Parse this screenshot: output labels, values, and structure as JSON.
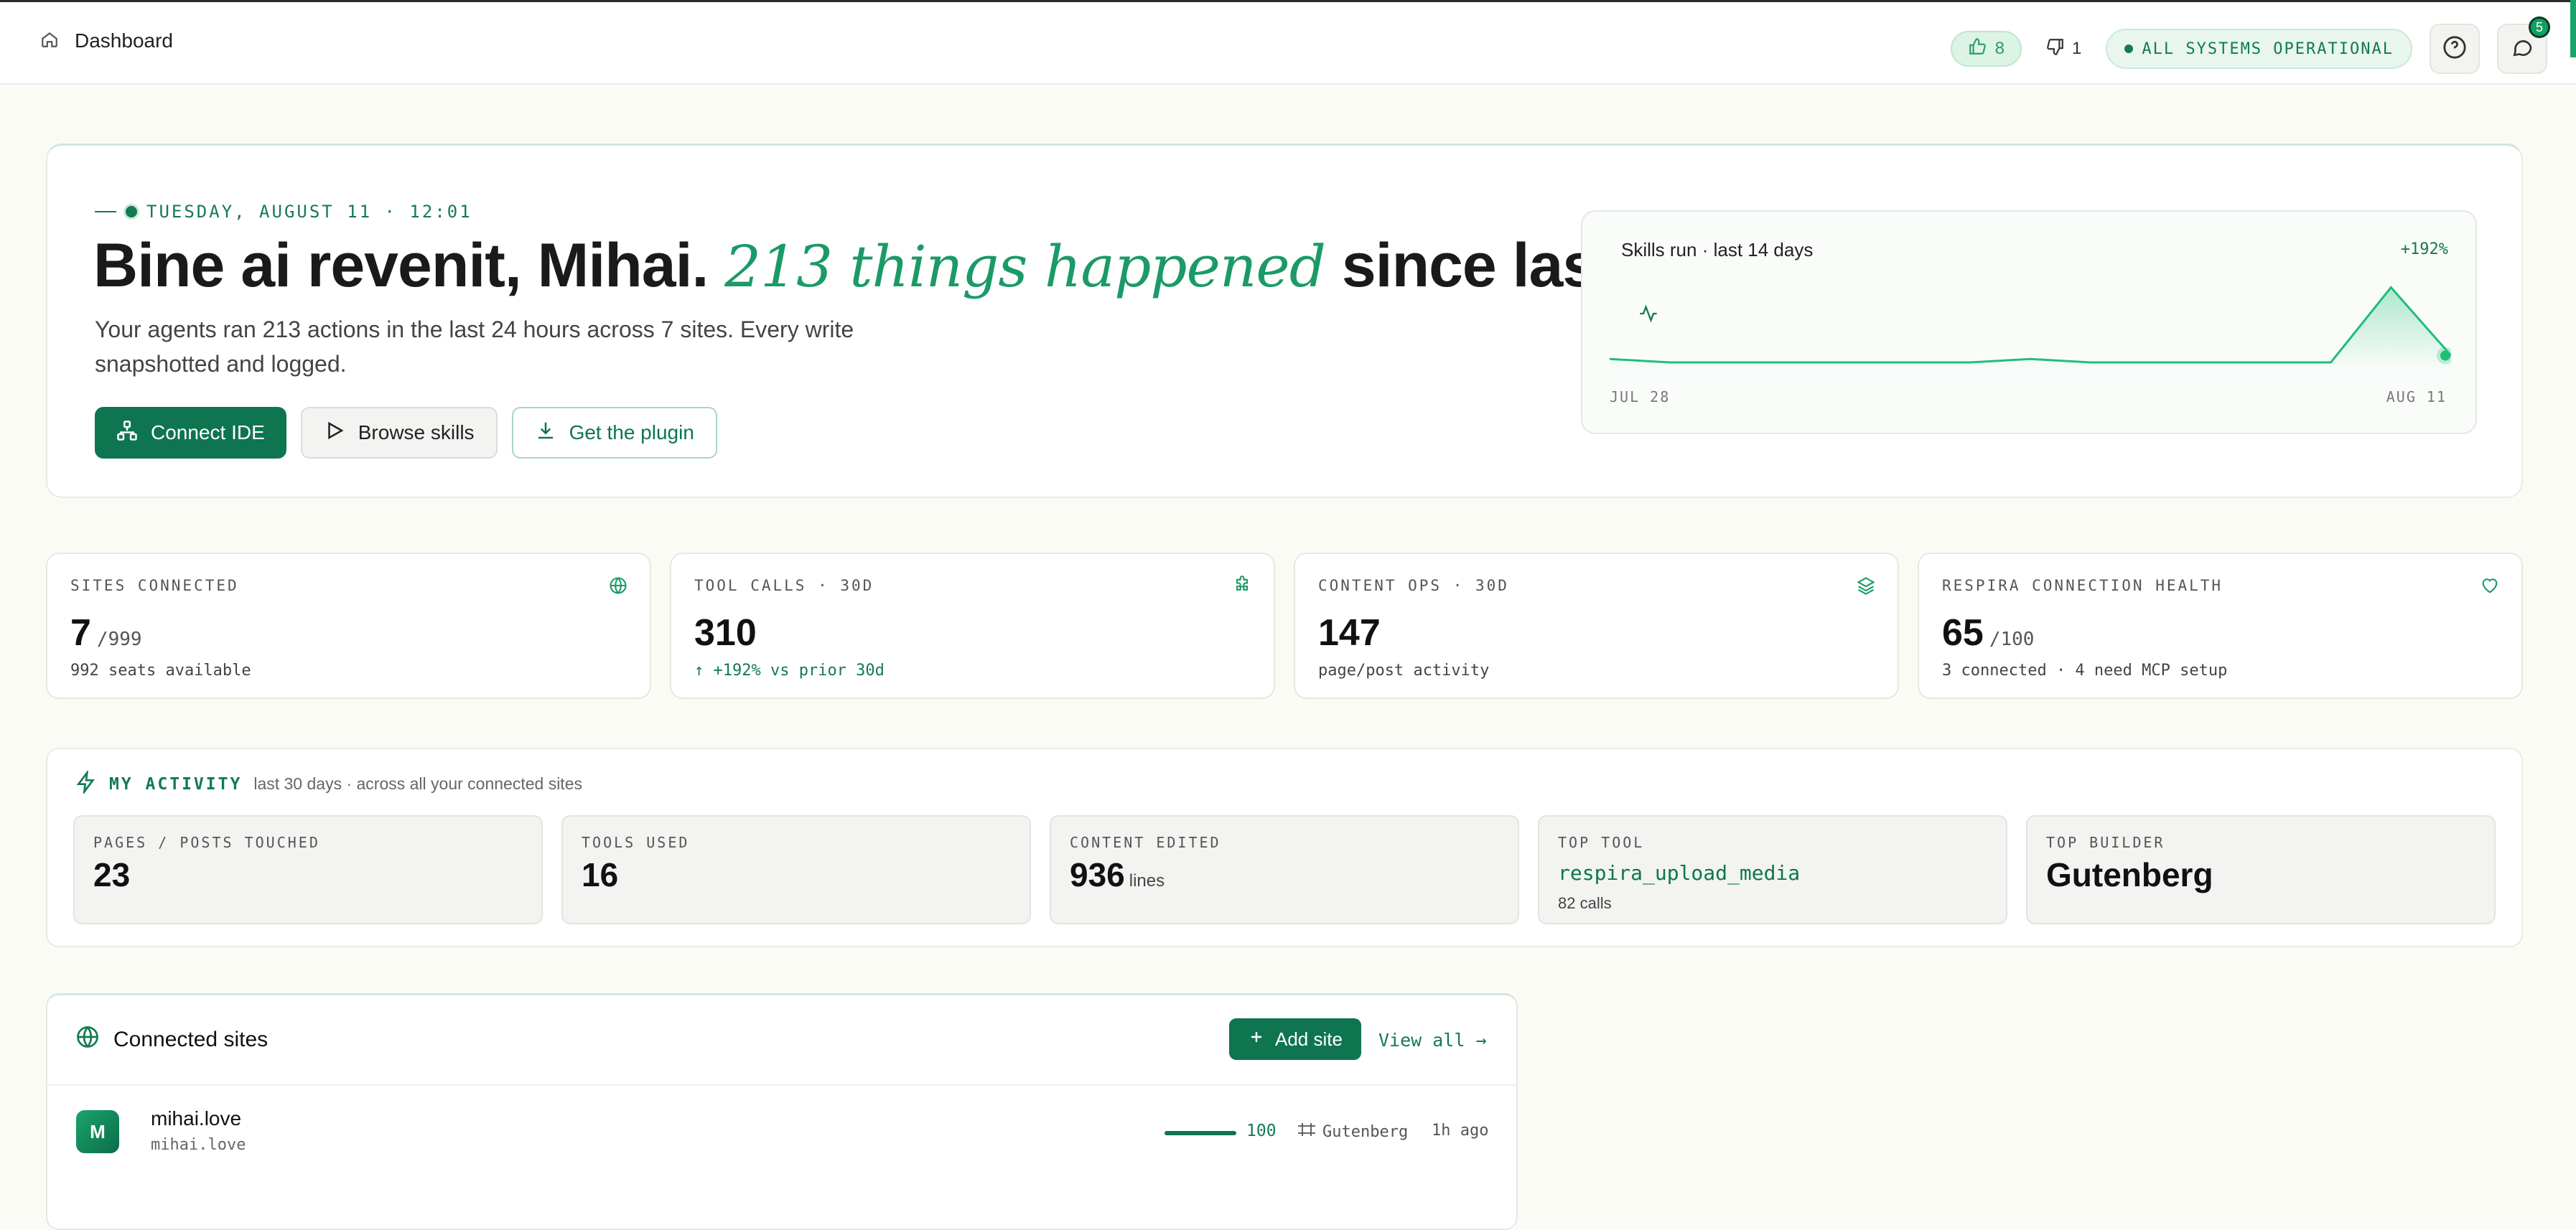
{
  "header": {
    "breadcrumb": "Dashboard",
    "likes": "8",
    "dislikes": "1",
    "status": "ALL SYSTEMS OPERATIONAL",
    "notification_count": "5"
  },
  "hero": {
    "date": "TUESDAY, AUGUST 11 · 12:01",
    "greeting": "Bine ai revenit, Mihai.",
    "highlight": "213 things happened",
    "tail": "since last night.",
    "subtitle": "Your agents ran 213 actions in the last 24 hours across 7 sites. Every write snapshotted and logged.",
    "buttons": {
      "connect": "Connect IDE",
      "browse": "Browse skills",
      "plugin": "Get the plugin"
    }
  },
  "sparkline": {
    "title": "Skills run · last 14 days",
    "change": "+192%",
    "x_start": "JUL 28",
    "x_end": "AUG 11"
  },
  "chart_data": {
    "type": "area",
    "title": "Skills run · last 14 days",
    "categories": [
      "JUL 28",
      "",
      "",
      "",
      "",
      "",
      "",
      "",
      "",
      "",
      "",
      "",
      "",
      "",
      "AUG 11"
    ],
    "values": [
      1,
      0,
      0,
      0,
      0,
      0,
      0,
      1,
      0,
      0,
      0,
      0,
      0,
      22,
      2
    ],
    "ylim": [
      0,
      24
    ],
    "grid": false
  },
  "stats": [
    {
      "label": "SITES CONNECTED",
      "value": "7",
      "suffix": "/999",
      "note": "992 seats available"
    },
    {
      "label": "TOOL CALLS · 30D",
      "value": "310",
      "suffix": "",
      "note": "+192% vs prior 30d"
    },
    {
      "label": "CONTENT OPS · 30D",
      "value": "147",
      "suffix": "",
      "note": "page/post activity"
    },
    {
      "label": "RESPIRA CONNECTION HEALTH",
      "value": "65",
      "suffix": "/100",
      "note": "3 connected · 4 need MCP setup"
    }
  ],
  "activity": {
    "title": "MY ACTIVITY",
    "subtitle": "last 30 days · across all your connected sites",
    "tiles": {
      "pages": {
        "label": "PAGES / POSTS TOUCHED",
        "value": "23"
      },
      "tools": {
        "label": "TOOLS USED",
        "value": "16"
      },
      "content": {
        "label": "CONTENT EDITED",
        "value": "936",
        "unit": "lines"
      },
      "top_tool": {
        "label": "TOP TOOL",
        "value": "respira_upload_media",
        "calls": "82 calls"
      },
      "top_builder": {
        "label": "TOP BUILDER",
        "value": "Gutenberg"
      }
    }
  },
  "sites": {
    "title": "Connected sites",
    "add": "Add site",
    "view_all": "View all →",
    "rows": [
      {
        "initial": "M",
        "name": "mihai.love",
        "domain": "mihai.love",
        "score": "100",
        "builder": "Gutenberg",
        "ago": "1h ago"
      }
    ]
  },
  "colors": {
    "accent": "#0e7550",
    "accent_light": "#1b9a68",
    "background": "#fbfbf6"
  }
}
